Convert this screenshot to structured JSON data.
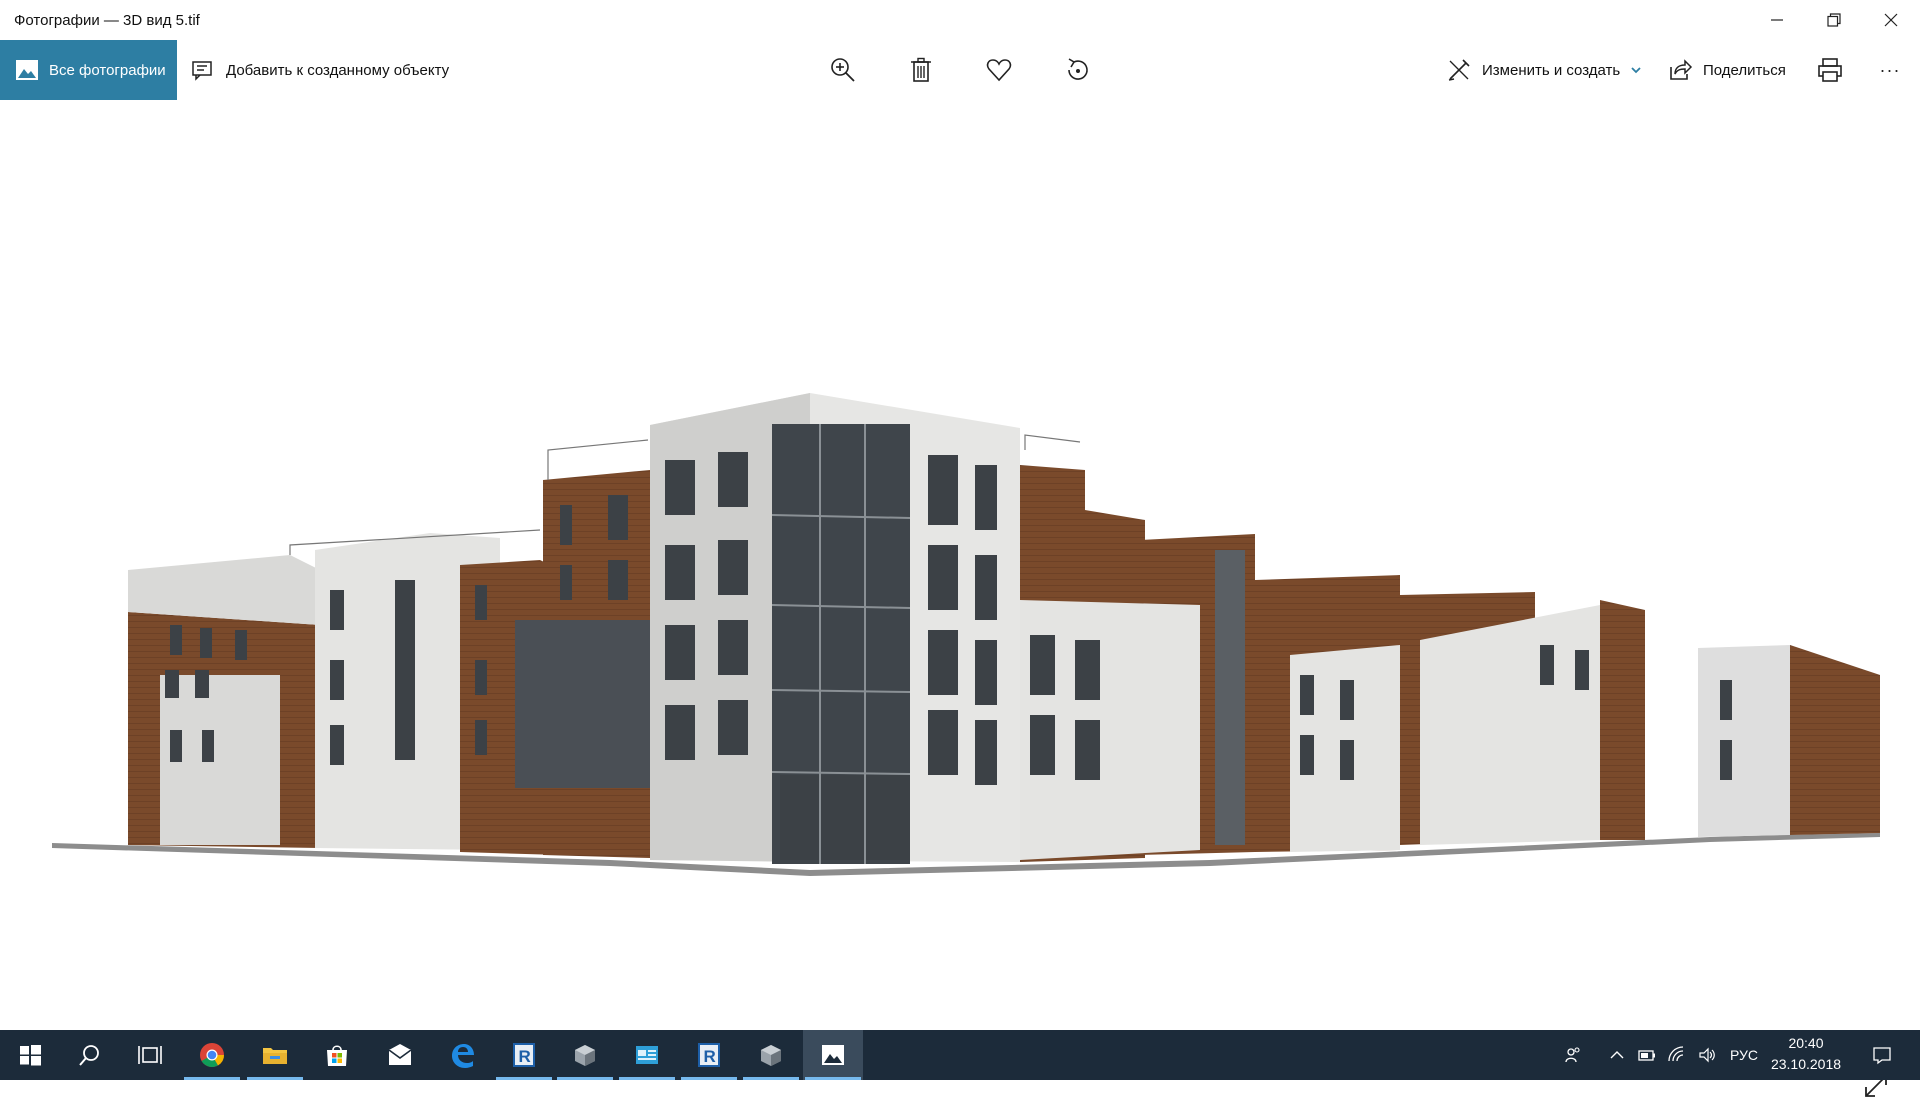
{
  "window": {
    "title": "Фотографии — 3D вид 5.tif"
  },
  "toolbar": {
    "all_photos_label": "Все фотографии",
    "add_to_creation_label": "Добавить к созданному объекту",
    "edit_create_label": "Изменить и создать",
    "share_label": "Поделиться",
    "more_label": "···"
  },
  "taskbar": {
    "language": "РУС",
    "time": "20:40",
    "date": "23.10.2018",
    "apps": [
      "start-icon",
      "search-icon",
      "task-view-icon",
      "chrome-icon",
      "file-explorer-icon",
      "store-icon",
      "mail-icon",
      "edge-icon",
      "revit-icon",
      "app-cube-icon",
      "app-window-icon",
      "revit-icon",
      "app-cube-icon",
      "photos-icon"
    ]
  },
  "colors": {
    "accent": "#2d7ea3",
    "taskbar": "#1c2b3a",
    "brick": "#7a4a2b",
    "facade_light": "#e3e3e1"
  }
}
